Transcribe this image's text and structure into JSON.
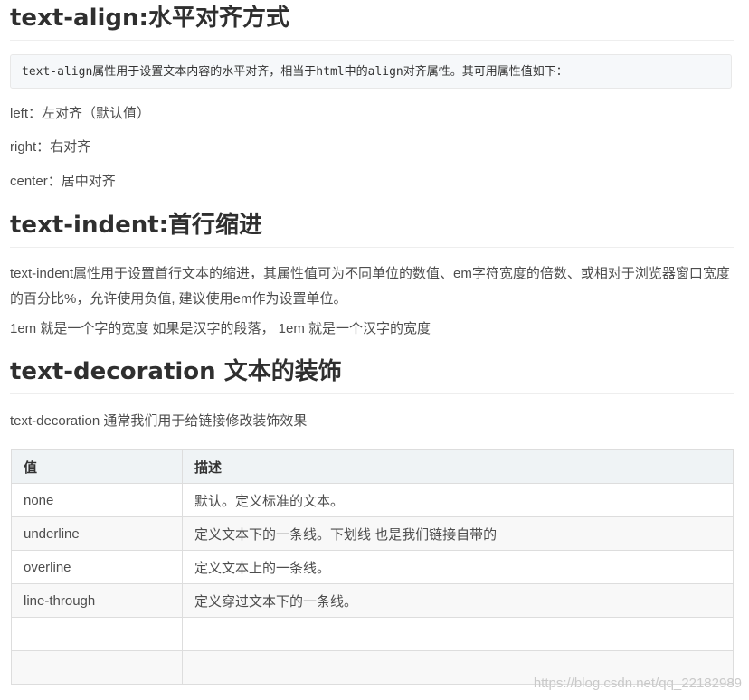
{
  "sections": [
    {
      "title": "text-align:水平对齐方式",
      "code_prefix": "text-align",
      "code_mid1": "属性用于设置文本内容的水平对齐，相当于",
      "code_html": "html",
      "code_mid2": "中的",
      "code_align": "align",
      "code_suffix": "对齐属性。其可用属性值如下：",
      "lines": [
        "left：左对齐（默认值）",
        "right：右对齐",
        "center：居中对齐"
      ]
    },
    {
      "title": "text-indent:首行缩进",
      "paragraph": "text-indent属性用于设置首行文本的缩进，其属性值可为不同单位的数值、em字符宽度的倍数、或相对于浏览器窗口宽度的百分比%，允许使用负值, 建议使用em作为设置单位。",
      "note": "1em 就是一个字的宽度   如果是汉字的段落， 1em 就是一个汉字的宽度"
    },
    {
      "title": "text-decoration 文本的装饰",
      "intro": "text-decoration   通常我们用于给链接修改装饰效果"
    }
  ],
  "table": {
    "headers": [
      "值",
      "描述"
    ],
    "rows": [
      [
        "none",
        "默认。定义标准的文本。"
      ],
      [
        "underline",
        "定义文本下的一条线。下划线 也是我们链接自带的"
      ],
      [
        "overline",
        "定义文本上的一条线。"
      ],
      [
        "line-through",
        "定义穿过文本下的一条线。"
      ],
      [
        "",
        ""
      ],
      [
        "",
        ""
      ]
    ]
  },
  "watermark": "https://blog.csdn.net/qq_22182989"
}
